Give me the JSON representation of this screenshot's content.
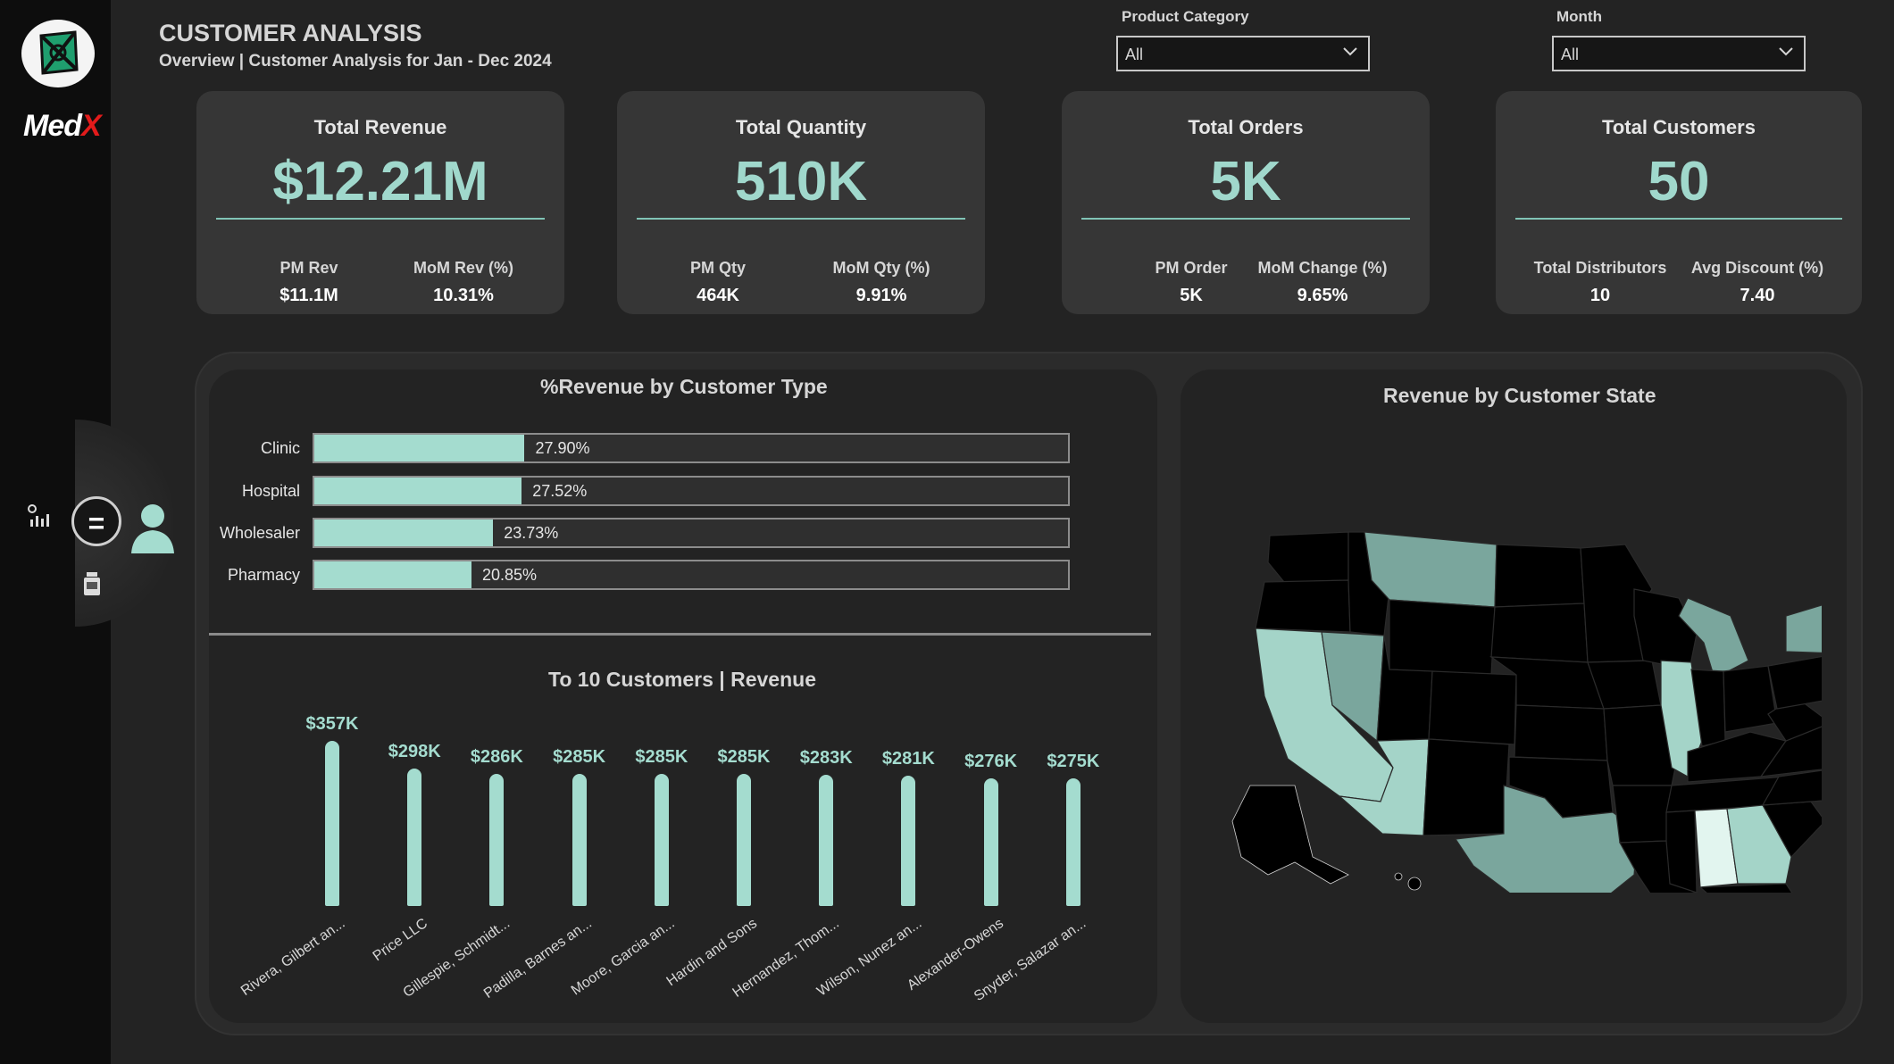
{
  "brand": {
    "logo_text_main": "Med",
    "logo_text_accent": "X"
  },
  "header": {
    "title": "CUSTOMER ANALYSIS",
    "subtitle": "Overview | Customer Analysis for Jan - Dec 2024"
  },
  "filters": {
    "product_category": {
      "label": "Product Category",
      "value": "All"
    },
    "month": {
      "label": "Month",
      "value": "All"
    }
  },
  "kpis": {
    "revenue": {
      "title": "Total Revenue",
      "value": "$12.21M",
      "sub1_label": "PM Rev",
      "sub1_value": "$11.1M",
      "sub2_label": "MoM Rev (%)",
      "sub2_value": "10.31%"
    },
    "quantity": {
      "title": "Total Quantity",
      "value": "510K",
      "sub1_label": "PM Qty",
      "sub1_value": "464K",
      "sub2_label": "MoM Qty (%)",
      "sub2_value": "9.91%"
    },
    "orders": {
      "title": "Total Orders",
      "value": "5K",
      "sub1_label": "PM Order",
      "sub1_value": "5K",
      "sub2_label": "MoM Change (%)",
      "sub2_value": "9.65%"
    },
    "customers": {
      "title": "Total Customers",
      "value": "50",
      "sub1_label": "Total Distributors",
      "sub1_value": "10",
      "sub2_label": "Avg Discount (%)",
      "sub2_value": "7.40"
    }
  },
  "nav": {
    "icons": [
      "chart-icon",
      "menu-toggle-icon",
      "user-icon",
      "bottle-icon"
    ],
    "toggle_glyph": "="
  },
  "chart_data": [
    {
      "type": "bar",
      "orientation": "horizontal",
      "title": "%Revenue by Customer Type",
      "categories": [
        "Clinic",
        "Hospital",
        "Wholesaler",
        "Pharmacy"
      ],
      "values": [
        27.9,
        27.52,
        23.73,
        20.85
      ],
      "value_labels": [
        "27.90%",
        "27.52%",
        "23.73%",
        "20.85%"
      ],
      "xlim": [
        0,
        100
      ],
      "color": "#a4dccf"
    },
    {
      "type": "bar",
      "title": "To 10 Customers | Revenue",
      "categories": [
        "Rivera, Gilbert an...",
        "Price LLC",
        "Gillespie, Schmidt...",
        "Padilla, Barnes an...",
        "Moore, Garcia an...",
        "Hardin and Sons",
        "Hernandez, Thom...",
        "Wilson, Nunez an...",
        "Alexander-Owens",
        "Snyder, Salazar an..."
      ],
      "values": [
        357,
        298,
        286,
        285,
        285,
        285,
        283,
        281,
        276,
        275
      ],
      "value_labels": [
        "$357K",
        "$298K",
        "$286K",
        "$285K",
        "$285K",
        "$285K",
        "$283K",
        "$281K",
        "$276K",
        "$275K"
      ],
      "ylim": [
        0,
        357
      ],
      "color": "#a4dccf"
    },
    {
      "type": "map",
      "title": "Revenue by Customer State",
      "colors": {
        "high": "#e2f5ef",
        "mid": "#a4d4c8",
        "low": "#7aa69d",
        "none": "#000000"
      }
    }
  ]
}
